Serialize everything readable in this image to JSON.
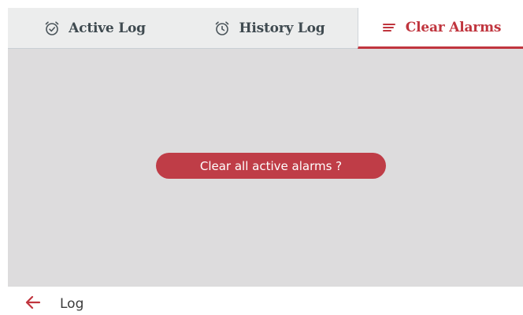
{
  "tabs": [
    {
      "label": "Active Log",
      "icon": "alarm-clock-check-icon",
      "active": false
    },
    {
      "label": "History Log",
      "icon": "alarm-clock-icon",
      "active": false
    },
    {
      "label": "Clear Alarms",
      "icon": "menu-lines-icon",
      "active": true
    }
  ],
  "main": {
    "clear_button_label": "Clear all active alarms ?"
  },
  "footer": {
    "back_icon": "arrow-left-icon",
    "label": "Log"
  },
  "colors": {
    "accent": "#c0353e",
    "button_bg": "#bf3d47",
    "tab_bar_bg": "#eceded",
    "content_bg": "#dddcdd",
    "tab_text": "#3f4a50"
  }
}
